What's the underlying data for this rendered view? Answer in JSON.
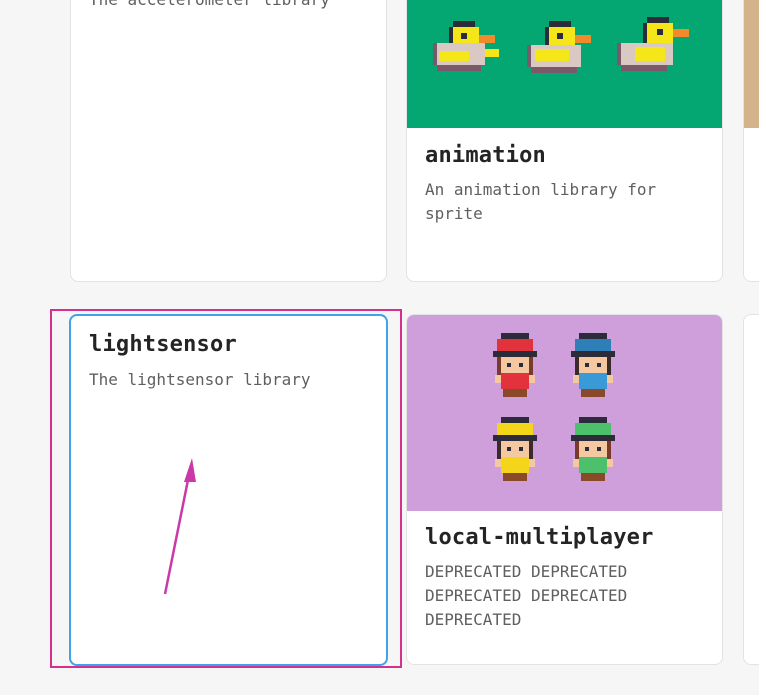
{
  "cards": {
    "accelerometer": {
      "desc": "The accelerometer library"
    },
    "animation": {
      "title": "animation",
      "desc": "An animation library for sprite",
      "thumb_color": "#04a771"
    },
    "lightsensor": {
      "title": "lightsensor",
      "desc": "The lightsensor library",
      "selected": true
    },
    "local_multiplayer": {
      "title": "local-multiplayer",
      "desc": "DEPRECATED DEPRECATED DEPRECATED DEPRECATED DEPRECATED",
      "thumb_color": "#cf9fdb"
    }
  },
  "annotation": {
    "highlight_color": "#d6308f",
    "arrow_color": "#c93aa8"
  },
  "colors": {
    "background": "#f6f6f6",
    "card_border": "#e3e3e3",
    "selected_border": "#3ea3e8",
    "peek_right_top": "#d4b28a"
  }
}
